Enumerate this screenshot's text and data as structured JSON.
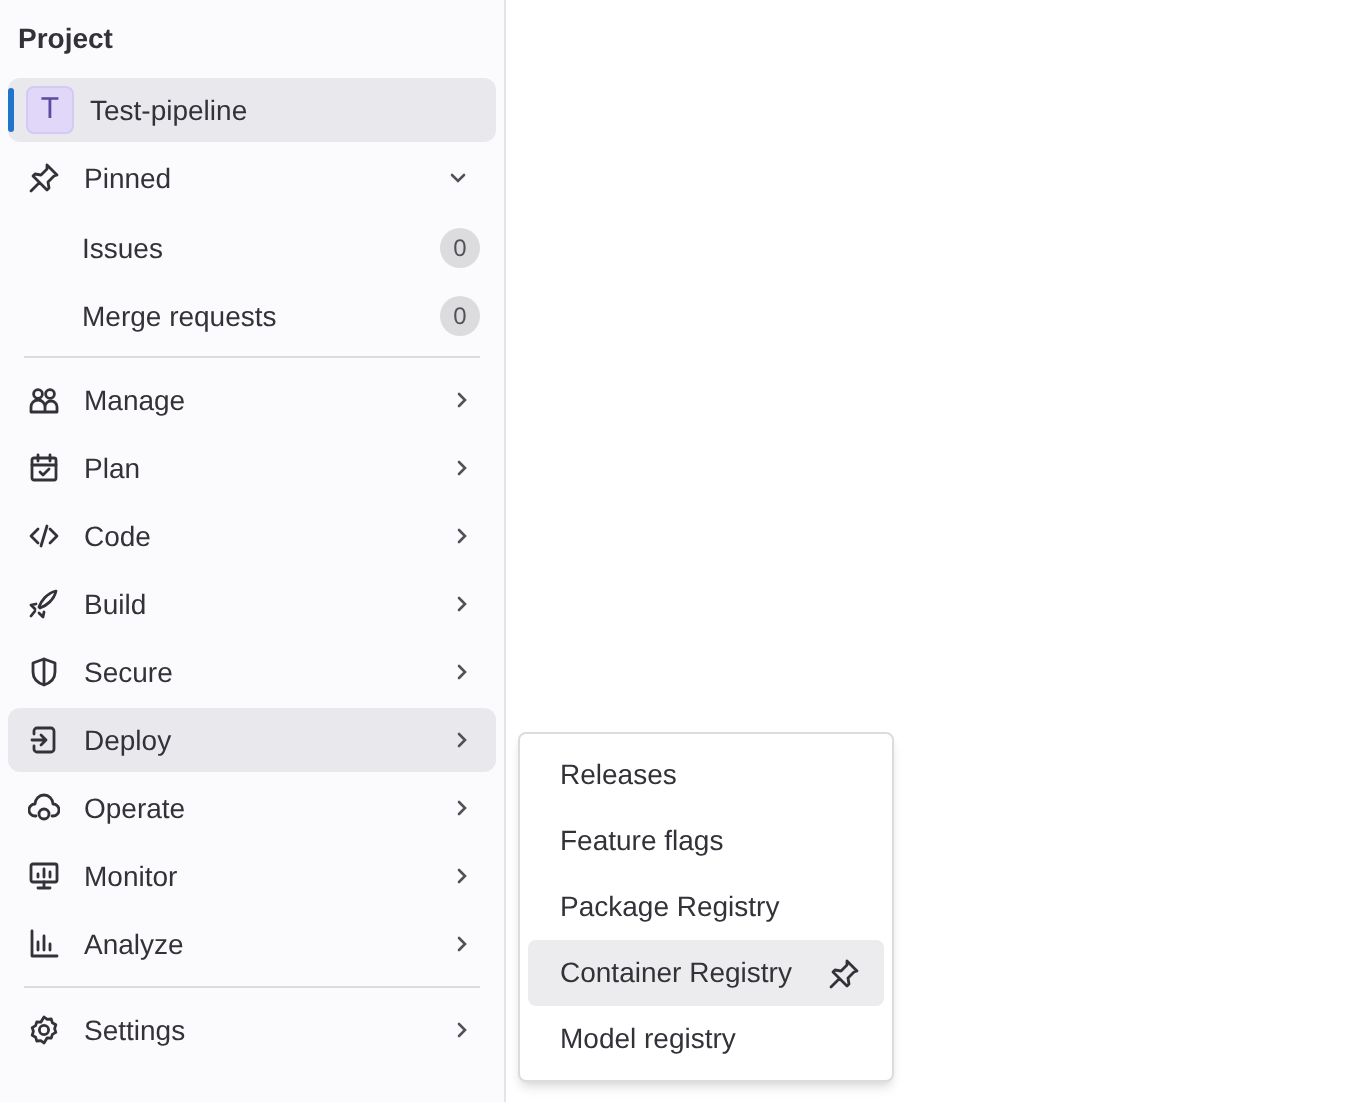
{
  "sidebar": {
    "title": "Project",
    "project": {
      "letter": "T",
      "name": "Test-pipeline",
      "selected": true
    },
    "pinned": {
      "label": "Pinned",
      "expanded": true,
      "items": [
        {
          "label": "Issues",
          "count": "0"
        },
        {
          "label": "Merge requests",
          "count": "0"
        }
      ]
    },
    "nav": [
      {
        "kind": "manage",
        "label": "Manage",
        "selected": false
      },
      {
        "kind": "plan",
        "label": "Plan",
        "selected": false
      },
      {
        "kind": "code",
        "label": "Code",
        "selected": false
      },
      {
        "kind": "build",
        "label": "Build",
        "selected": false
      },
      {
        "kind": "secure",
        "label": "Secure",
        "selected": false
      },
      {
        "kind": "deploy",
        "label": "Deploy",
        "selected": true
      },
      {
        "kind": "operate",
        "label": "Operate",
        "selected": false
      },
      {
        "kind": "monitor",
        "label": "Monitor",
        "selected": false
      },
      {
        "kind": "analyze",
        "label": "Analyze",
        "selected": false
      }
    ],
    "footer": [
      {
        "kind": "settings",
        "label": "Settings",
        "selected": false
      }
    ]
  },
  "flyout": {
    "items": [
      {
        "label": "Releases",
        "selected": false
      },
      {
        "label": "Feature flags",
        "selected": false
      },
      {
        "label": "Package Registry",
        "selected": false
      },
      {
        "label": "Container Registry",
        "selected": true
      },
      {
        "label": "Model registry",
        "selected": false
      }
    ]
  }
}
